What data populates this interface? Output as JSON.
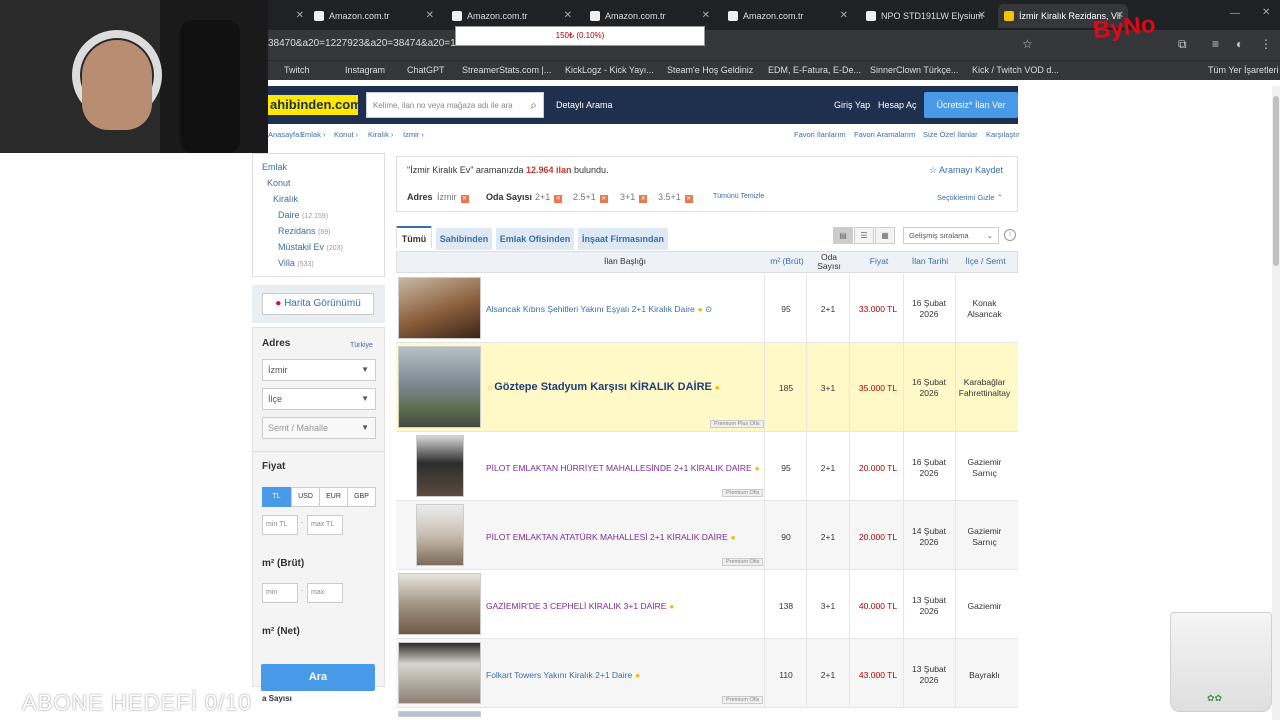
{
  "browser": {
    "tabs": [
      {
        "label": "Amazon.com.tr",
        "active": false
      },
      {
        "label": "Amazon.com.tr",
        "active": false
      },
      {
        "label": "Amazon.com.tr",
        "active": false
      },
      {
        "label": "Amazon.com.tr",
        "active": false
      },
      {
        "label": "NPO STD191LW Elysium",
        "active": false
      },
      {
        "label": "İzmir Kiralık Rezidans, Vil",
        "active": true
      }
    ],
    "url": "38470&a20=1227923&a20=38474&a20=122",
    "ticker_text": "150₺ (0.10%)",
    "bookmarks": [
      "Twitch",
      "Instagram",
      "ChatGPT",
      "StreamerStats.com |...",
      "KickLogz - Kick Yayı...",
      "Steam'e Hoş Geldiniz",
      "EDM, E-Fatura, E-De...",
      "SinnerClown Türkçe...",
      "Kick / Twitch VOD d...",
      "Tüm Yer İşaretleri"
    ]
  },
  "header": {
    "logo": "ahibinden.com",
    "search_placeholder": "Kelime, ilan no veya mağaza adı ile ara",
    "detailed_search": "Detaylı Arama",
    "login": "Giriş Yap",
    "signup": "Hesap Aç",
    "post_ad": "Ücretsiz* İlan Ver"
  },
  "breadcrumb": {
    "items": [
      "Anasayfa ›",
      "Emlak ›",
      "Konut ›",
      "Kiralık ›",
      "İzmir ›"
    ],
    "right": [
      "Favori İlanlarım",
      "Favori Aramalarım",
      "Size Özel İlanlar",
      "Karşılaştır"
    ]
  },
  "sidebar": {
    "categories": [
      {
        "label": "Emlak",
        "count": ""
      },
      {
        "label": "Konut",
        "count": ""
      },
      {
        "label": "Kiralık",
        "count": ""
      },
      {
        "label": "Daire",
        "count": "(12.159)"
      },
      {
        "label": "Rezidans",
        "count": "(69)"
      },
      {
        "label": "Müstakil Ev",
        "count": "(203)"
      },
      {
        "label": "Villa",
        "count": "(533)"
      }
    ],
    "map_view": "Harita Görünümü",
    "address_title": "Adres",
    "country_link": "Türkiye",
    "city": "İzmir",
    "district": "İlçe",
    "neighborhood": "Semt / Mahalle",
    "price_title": "Fiyat",
    "currencies": [
      "TL",
      "USD",
      "EUR",
      "GBP"
    ],
    "min_price": "min TL",
    "max_price": "max TL",
    "gross_title": "m² (Brüt)",
    "net_title": "m² (Net)",
    "min": "min",
    "max": "max",
    "rooms_title": "a Sayısı",
    "search_button": "Ara"
  },
  "overlay": {
    "watermark": "ABONE HEDEFİ 0/10",
    "logo": "ByNo"
  },
  "results": {
    "query": "\"İzmir Kiralık Ev\"",
    "query_suffix": "aramanızda",
    "count": "12.964 ilan",
    "found": "bulundu.",
    "save_search": "☆ Aramayı Kaydet",
    "filter_label_address": "Adres",
    "filter_city": "İzmir",
    "filter_label_rooms": "Oda Sayısı",
    "room_chips": [
      "2+1",
      "2.5+1",
      "3+1",
      "3.5+1"
    ],
    "clear_all": "Tümünü Temizle",
    "hide_selected": "Seçtiklerimi Gizle ⌃",
    "tabs": [
      "Tümü",
      "Sahibinden",
      "Emlak Ofisinden",
      "İnşaat Firmasından"
    ],
    "sort": "Gelişmiş sıralama",
    "columns": [
      "İlan Başlığı",
      "m² (Brüt)",
      "Oda Sayısı",
      "Fiyat",
      "İlan Tarihi",
      "İlçe / Semt"
    ],
    "rows": [
      {
        "title": "Alsancak Kıbrıs Şehitleri Yakını Eşyalı 2+1 Kiralık Daire",
        "m2": "95",
        "rooms": "2+1",
        "price": "33.000 TL",
        "date1": "16 Şubat",
        "date2": "2026",
        "loc1": "Konak",
        "loc2": "Alsancak",
        "badge": ""
      },
      {
        "title": "Göztepe Stadyum Karşısı KİRALIK DAİRE",
        "m2": "185",
        "rooms": "3+1",
        "price": "35.000 TL",
        "date1": "16 Şubat",
        "date2": "2026",
        "loc1": "Karabağlar",
        "loc2": "Fahrettinaltay",
        "badge": "Premium Plus Ofis"
      },
      {
        "title": "PİLOT EMLAKTAN HÜRRİYET MAHALLESİNDE 2+1 KİRALIK DAİRE",
        "m2": "95",
        "rooms": "2+1",
        "price": "20.000 TL",
        "date1": "16 Şubat",
        "date2": "2026",
        "loc1": "Gaziemir",
        "loc2": "Sarnıç",
        "badge": "Premium Ofis"
      },
      {
        "title": "PİLOT EMLAKTAN ATATÜRK MAHALLESİ 2+1 KİRALIK DAİRE",
        "m2": "90",
        "rooms": "2+1",
        "price": "20.000 TL",
        "date1": "14 Şubat",
        "date2": "2026",
        "loc1": "Gaziemir",
        "loc2": "Sarnıç",
        "badge": "Premium Ofis"
      },
      {
        "title": "GAZİEMİR'DE 3 CEPHELİ KİRALIK 3+1 DAİRE",
        "m2": "138",
        "rooms": "3+1",
        "price": "40.000 TL",
        "date1": "13 Şubat",
        "date2": "2026",
        "loc1": "Gaziemir",
        "loc2": "",
        "badge": ""
      },
      {
        "title": "Folkart Towers Yakını Kiralık 2+1 Daire",
        "m2": "110",
        "rooms": "2+1",
        "price": "43.000 TL",
        "date1": "13 Şubat",
        "date2": "2026",
        "loc1": "Bayraklı",
        "loc2": "",
        "badge": "Premium Ofis"
      }
    ]
  },
  "colors": {
    "brand_yellow": "#ffe800",
    "header_navy": "#1f2f4e",
    "accent_blue": "#489ae9",
    "price_red": "#b30000"
  }
}
